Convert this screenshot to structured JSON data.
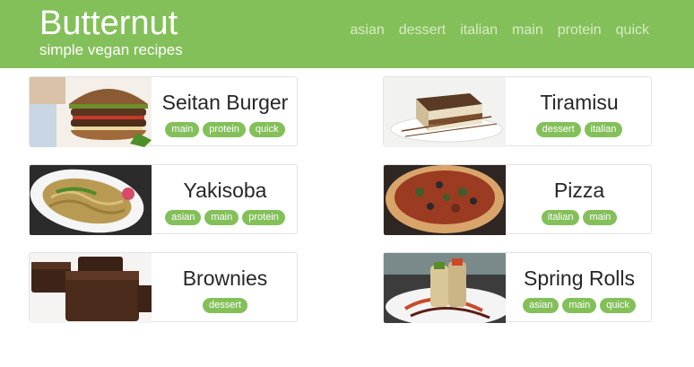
{
  "brand": {
    "title": "Butternut",
    "subtitle": "simple vegan recipes"
  },
  "nav": [
    "asian",
    "dessert",
    "italian",
    "main",
    "protein",
    "quick"
  ],
  "colors": {
    "accent": "#84c05a",
    "nav_text": "#d6ecc4"
  },
  "recipes": [
    {
      "name": "Seitan Burger",
      "tags": [
        "main",
        "protein",
        "quick"
      ],
      "image": "burger-photo"
    },
    {
      "name": "Tiramisu",
      "tags": [
        "dessert",
        "italian"
      ],
      "image": "tiramisu-photo"
    },
    {
      "name": "Yakisoba",
      "tags": [
        "asian",
        "main",
        "protein"
      ],
      "image": "yakisoba-photo"
    },
    {
      "name": "Pizza",
      "tags": [
        "italian",
        "main"
      ],
      "image": "pizza-photo"
    },
    {
      "name": "Brownies",
      "tags": [
        "dessert"
      ],
      "image": "brownies-photo"
    },
    {
      "name": "Spring Rolls",
      "tags": [
        "asian",
        "main",
        "quick"
      ],
      "image": "spring-rolls-photo"
    }
  ]
}
